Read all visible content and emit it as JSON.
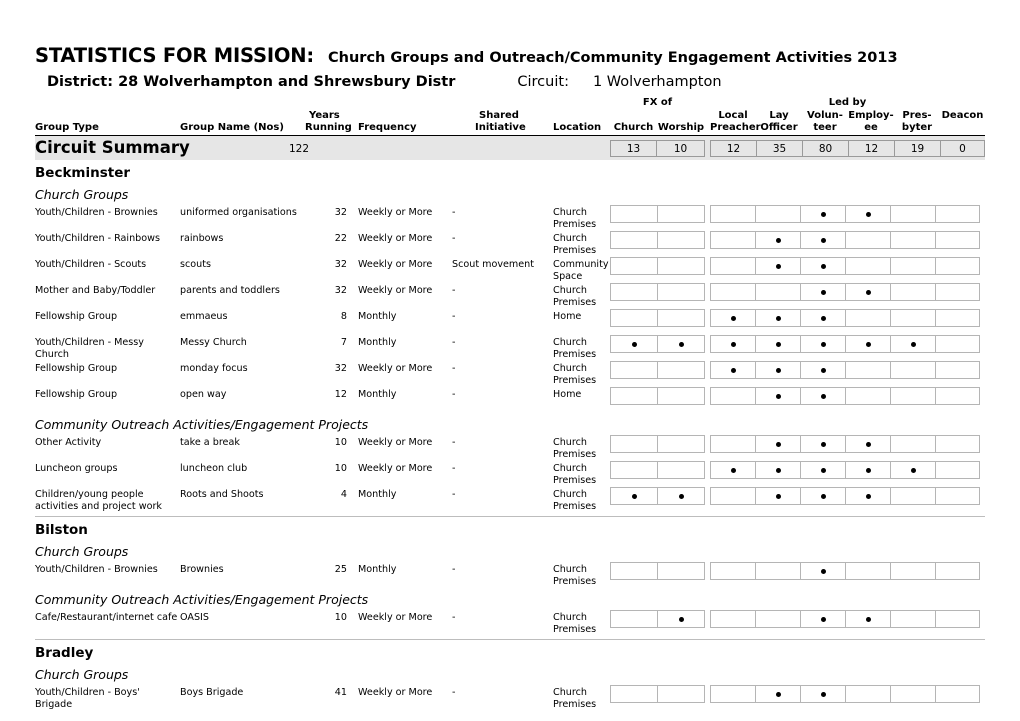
{
  "title": {
    "main": "STATISTICS FOR MISSION:",
    "sub": "Church Groups and Outreach/Community Engagement Activities 2013",
    "district": "District: 28 Wolverhampton and Shrewsbury Distr",
    "circuit_label": "Circuit:",
    "circuit_value": "1 Wolverhampton"
  },
  "header": {
    "group_type": "Group Type",
    "group_name": "Group Name (Nos)",
    "years": "Years",
    "running": "Running",
    "frequency": "Frequency",
    "shared": "Shared",
    "initiative": "Initiative",
    "location": "Location",
    "fx_of": "FX of",
    "led_by": "Led by",
    "fx_cols": [
      "Church",
      "Worship"
    ],
    "led_cols_top": [
      "Local",
      "Lay",
      "Volun-",
      "Employ-",
      "Pres-",
      "Deacon"
    ],
    "led_cols_bot": [
      "Preacher",
      "Officer",
      "teer",
      "ee",
      "byter",
      ""
    ]
  },
  "summary": {
    "label": "Circuit Summary",
    "count": "122",
    "fx": [
      "13",
      "10"
    ],
    "led": [
      "12",
      "35",
      "80",
      "12",
      "19",
      "0"
    ]
  },
  "section_labels": {
    "church_groups": "Church Groups",
    "outreach": "Community Outreach Activities/Engagement Projects"
  },
  "churches": [
    {
      "name": "Beckminster",
      "sections": [
        {
          "label": "Church Groups",
          "rows": [
            {
              "type": "Youth/Children - Brownies",
              "name": "uniformed organisations",
              "years": "32",
              "frequency": "Weekly or More",
              "shared": "-",
              "location": "Church Premises",
              "fx": [
                false,
                false
              ],
              "led": [
                false,
                false,
                true,
                true,
                false,
                false
              ]
            },
            {
              "type": "Youth/Children - Rainbows",
              "name": "rainbows",
              "years": "22",
              "frequency": "Weekly or More",
              "shared": "-",
              "location": "Church Premises",
              "fx": [
                false,
                false
              ],
              "led": [
                false,
                true,
                true,
                false,
                false,
                false
              ]
            },
            {
              "type": "Youth/Children - Scouts",
              "name": "scouts",
              "years": "32",
              "frequency": "Weekly or More",
              "shared": "Scout movement",
              "location": "Community Space",
              "fx": [
                false,
                false
              ],
              "led": [
                false,
                true,
                true,
                false,
                false,
                false
              ]
            },
            {
              "type": "Mother and Baby/Toddler",
              "name": "parents and toddlers",
              "years": "32",
              "frequency": "Weekly or More",
              "shared": "-",
              "location": "Church Premises",
              "fx": [
                false,
                false
              ],
              "led": [
                false,
                false,
                true,
                true,
                false,
                false
              ]
            },
            {
              "type": "Fellowship Group",
              "name": "emmaeus",
              "years": "8",
              "frequency": "Monthly",
              "shared": "-",
              "location": "Home",
              "fx": [
                false,
                false
              ],
              "led": [
                true,
                true,
                true,
                false,
                false,
                false
              ]
            },
            {
              "type": "Youth/Children - Messy Church",
              "name": "Messy Church",
              "years": "7",
              "frequency": "Monthly",
              "shared": "-",
              "location": "Church Premises",
              "fx": [
                true,
                true
              ],
              "led": [
                true,
                true,
                true,
                true,
                true,
                false
              ]
            },
            {
              "type": "Fellowship Group",
              "name": "monday focus",
              "years": "32",
              "frequency": "Weekly or More",
              "shared": "-",
              "location": "Church Premises",
              "fx": [
                false,
                false
              ],
              "led": [
                true,
                true,
                true,
                false,
                false,
                false
              ]
            },
            {
              "type": "Fellowship Group",
              "name": "open way",
              "years": "12",
              "frequency": "Monthly",
              "shared": "-",
              "location": "Home",
              "fx": [
                false,
                false
              ],
              "led": [
                false,
                true,
                true,
                false,
                false,
                false
              ]
            }
          ]
        },
        {
          "label": "Community Outreach Activities/Engagement Projects",
          "rows": [
            {
              "type": "Other Activity",
              "name": "take a break",
              "years": "10",
              "frequency": "Weekly or More",
              "shared": "-",
              "location": "Church Premises",
              "fx": [
                false,
                false
              ],
              "led": [
                false,
                true,
                true,
                true,
                false,
                false
              ]
            },
            {
              "type": "Luncheon groups",
              "name": "luncheon club",
              "years": "10",
              "frequency": "Weekly or More",
              "shared": "-",
              "location": "Church Premises",
              "fx": [
                false,
                false
              ],
              "led": [
                true,
                true,
                true,
                true,
                true,
                false
              ]
            },
            {
              "type": "Children/young people activities and project work",
              "name": "Roots and Shoots",
              "years": "4",
              "frequency": "Monthly",
              "shared": "-",
              "location": "Church Premises",
              "fx": [
                true,
                true
              ],
              "led": [
                false,
                true,
                true,
                true,
                false,
                false
              ]
            }
          ]
        }
      ]
    },
    {
      "name": "Bilston",
      "sections": [
        {
          "label": "Church Groups",
          "rows": [
            {
              "type": "Youth/Children - Brownies",
              "name": "Brownies",
              "years": "25",
              "frequency": "Monthly",
              "shared": "-",
              "location": "Church Premises",
              "fx": [
                false,
                false
              ],
              "led": [
                false,
                false,
                true,
                false,
                false,
                false
              ]
            }
          ]
        },
        {
          "label": "Community Outreach Activities/Engagement Projects",
          "rows": [
            {
              "type": "Cafe/Restaurant/internet cafe",
              "name": "OASIS",
              "years": "10",
              "frequency": "Weekly or More",
              "shared": "-",
              "location": "Church Premises",
              "fx": [
                false,
                true
              ],
              "led": [
                false,
                false,
                true,
                true,
                false,
                false
              ]
            }
          ]
        }
      ]
    },
    {
      "name": "Bradley",
      "sections": [
        {
          "label": "Church Groups",
          "rows": [
            {
              "type": "Youth/Children - Boys' Brigade",
              "name": "Boys Brigade",
              "years": "41",
              "frequency": "Weekly or More",
              "shared": "-",
              "location": "Church Premises",
              "fx": [
                false,
                false
              ],
              "led": [
                false,
                true,
                true,
                false,
                false,
                false
              ]
            }
          ]
        }
      ]
    }
  ]
}
